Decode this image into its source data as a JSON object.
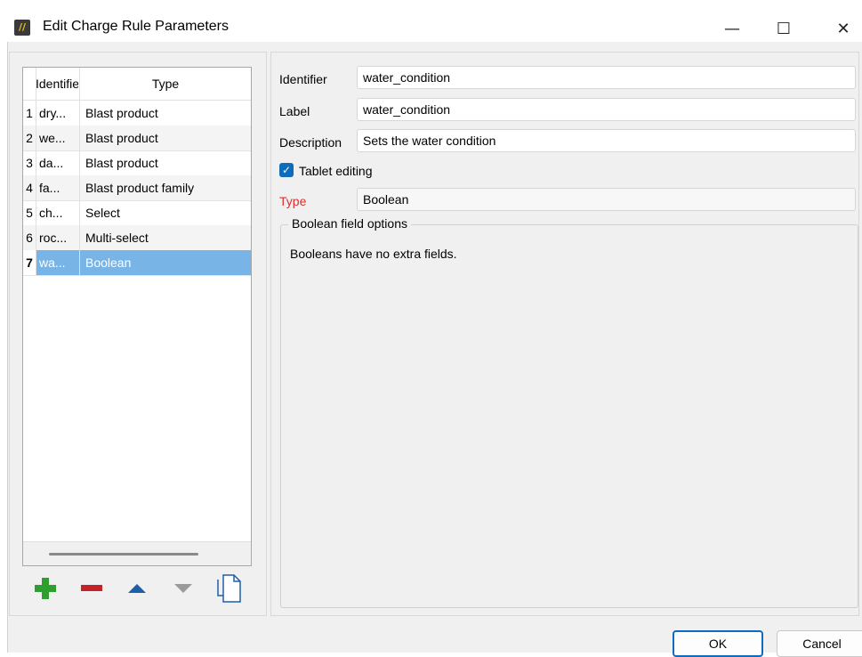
{
  "window": {
    "title": "Edit Charge Rule Parameters",
    "app_icon_text": "//",
    "controls": {
      "minimize": "—",
      "maximize": "☐",
      "close": "✕"
    }
  },
  "list": {
    "columns": {
      "identifier": "Identifie",
      "type": "Type"
    },
    "rows": [
      {
        "num": "1",
        "id": "dry...",
        "type": "Blast product"
      },
      {
        "num": "2",
        "id": "we...",
        "type": "Blast product"
      },
      {
        "num": "3",
        "id": "da...",
        "type": "Blast product"
      },
      {
        "num": "4",
        "id": "fa...",
        "type": "Blast product family"
      },
      {
        "num": "5",
        "id": "ch...",
        "type": "Select"
      },
      {
        "num": "6",
        "id": "roc...",
        "type": "Multi-select"
      },
      {
        "num": "7",
        "id": "wa...",
        "type": "Boolean"
      }
    ],
    "selected_index": 6
  },
  "toolbar": {
    "icons": [
      "add-icon",
      "remove-icon",
      "move-up-icon",
      "move-down-icon",
      "copy-icon"
    ],
    "colors": {
      "add": "#2e9e2e",
      "remove": "#c4222a",
      "up": "#1f5fa8",
      "down": "#9a9a9a"
    }
  },
  "form": {
    "identifier_label": "Identifier",
    "identifier_value": "water_condition",
    "label_label": "Label",
    "label_value": "water_condition",
    "description_label": "Description",
    "description_value": "Sets the water condition",
    "tablet_editing_label": "Tablet editing",
    "tablet_editing_checked": true,
    "type_label": "Type",
    "type_value": "Boolean",
    "type_label_color": "#d9302f"
  },
  "options_group": {
    "title": "Boolean field options",
    "message": "Booleans have no extra fields."
  },
  "buttons": {
    "ok": "OK",
    "cancel": "Cancel"
  }
}
